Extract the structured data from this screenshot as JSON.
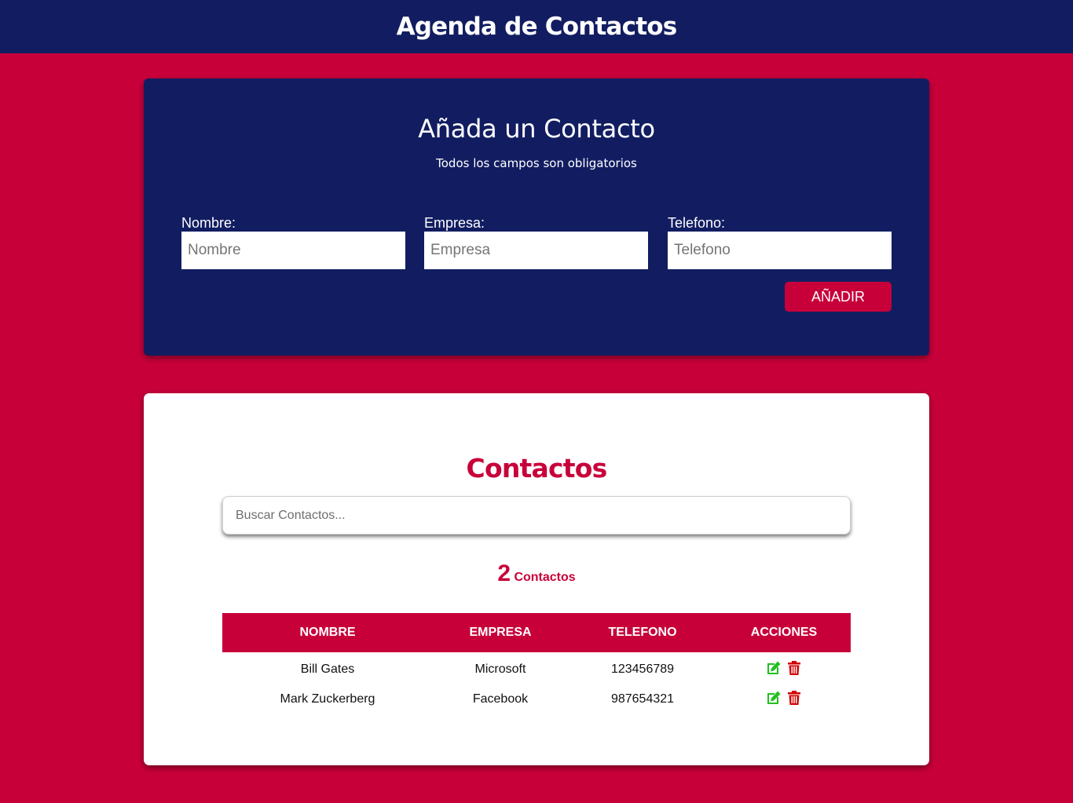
{
  "header": {
    "title": "Agenda de Contactos"
  },
  "form": {
    "title": "Añada un Contacto",
    "subtitle": "Todos los campos son obligatorios",
    "fields": [
      {
        "label": "Nombre:",
        "placeholder": "Nombre"
      },
      {
        "label": "Empresa:",
        "placeholder": "Empresa"
      },
      {
        "label": "Telefono:",
        "placeholder": "Telefono"
      }
    ],
    "submit_label": "AÑADIR"
  },
  "contacts": {
    "title": "Contactos",
    "search_placeholder": "Buscar Contactos...",
    "count": "2",
    "count_label": "Contactos",
    "columns": [
      "NOMBRE",
      "EMPRESA",
      "TELEFONO",
      "ACCIONES"
    ],
    "rows": [
      {
        "nombre": "Bill Gates",
        "empresa": "Microsoft",
        "telefono": "123456789"
      },
      {
        "nombre": "Mark Zuckerberg",
        "empresa": "Facebook",
        "telefono": "987654321"
      }
    ],
    "actions": {
      "edit_icon": "edit-icon",
      "delete_icon": "trash-icon"
    }
  },
  "colors": {
    "primary_navy": "#121d61",
    "accent_crimson": "#c8003a",
    "edit_green": "#22c020",
    "delete_red": "#d20000"
  }
}
